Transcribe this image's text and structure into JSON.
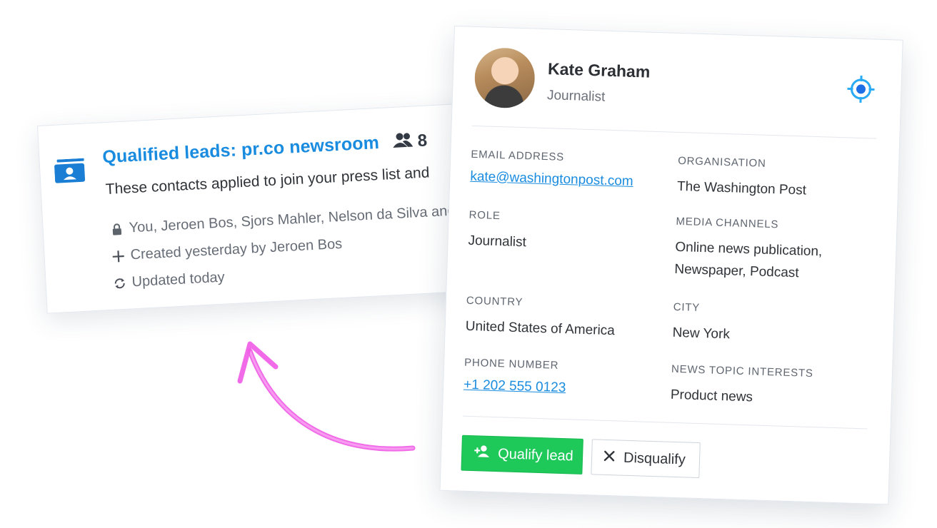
{
  "list": {
    "title": "Qualified leads: pr.co newsroom",
    "member_count": "8",
    "description": "These contacts applied to join your press list and",
    "access": "You, Jeroen Bos, Sjors Mahler, Nelson da Silva and",
    "created": "Created yesterday by Jeroen Bos",
    "updated": "Updated today",
    "icons": [
      "contact-card-icon",
      "people-icon",
      "lock-icon",
      "plus-icon",
      "refresh-icon"
    ]
  },
  "contact": {
    "name": "Kate Graham",
    "title": "Journalist",
    "fields": {
      "email": {
        "label": "EMAIL ADDRESS",
        "value": "kate@washingtonpost.com"
      },
      "organisation": {
        "label": "ORGANISATION",
        "value": "The Washington Post"
      },
      "role": {
        "label": "ROLE",
        "value": "Journalist"
      },
      "media_channels": {
        "label": "MEDIA CHANNELS",
        "value_line1": "Online news publication,",
        "value_line2": "Newspaper, Podcast"
      },
      "country": {
        "label": "COUNTRY",
        "value": "United States of America"
      },
      "city": {
        "label": "CITY",
        "value": "New York"
      },
      "phone": {
        "label": "PHONE NUMBER",
        "value": "+1 202 555 0123"
      },
      "news_topics": {
        "label": "NEWS TOPIC INTERESTS",
        "value": "Product news"
      }
    },
    "actions": {
      "qualify": "Qualify lead",
      "disqualify": "Disqualify"
    }
  },
  "colors": {
    "link": "#1a8cdf",
    "qualify_button": "#1ec95a",
    "target_icon": "#29aaf4",
    "arrow": "#f05be6"
  }
}
